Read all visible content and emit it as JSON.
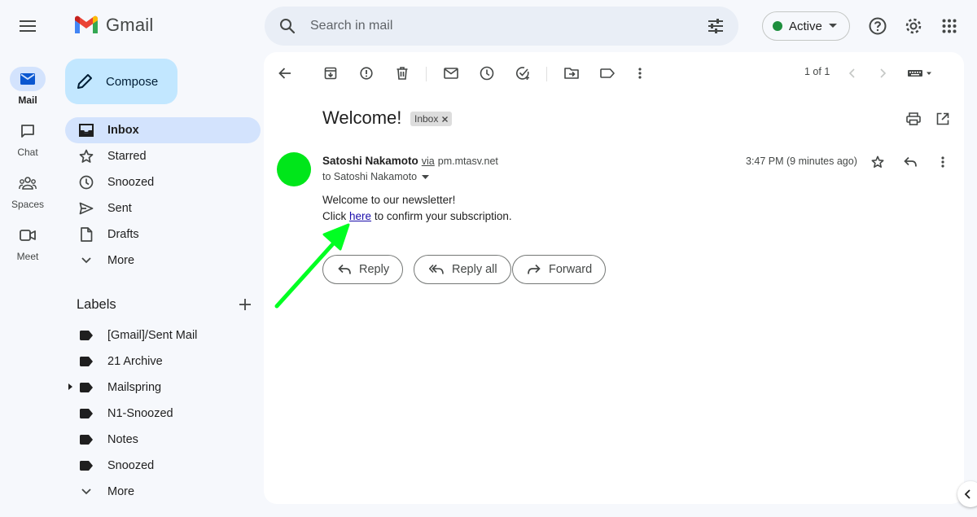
{
  "app": {
    "name": "Gmail"
  },
  "search": {
    "placeholder": "Search in mail"
  },
  "status": {
    "label": "Active",
    "color": "#1e8e3e"
  },
  "rail": [
    {
      "label": "Mail",
      "icon": "mail-icon",
      "active": true
    },
    {
      "label": "Chat",
      "icon": "chat-icon"
    },
    {
      "label": "Spaces",
      "icon": "spaces-icon"
    },
    {
      "label": "Meet",
      "icon": "meet-icon"
    }
  ],
  "compose": {
    "label": "Compose"
  },
  "nav": [
    {
      "label": "Inbox",
      "icon": "inbox-icon",
      "active": true
    },
    {
      "label": "Starred",
      "icon": "star-icon"
    },
    {
      "label": "Snoozed",
      "icon": "clock-icon"
    },
    {
      "label": "Sent",
      "icon": "send-icon"
    },
    {
      "label": "Drafts",
      "icon": "draft-icon"
    },
    {
      "label": "More",
      "icon": "chevron-down-icon"
    }
  ],
  "labels": {
    "title": "Labels",
    "items": [
      {
        "label": "[Gmail]/Sent Mail"
      },
      {
        "label": "21 Archive"
      },
      {
        "label": "Mailspring",
        "expandable": true
      },
      {
        "label": "N1-Snoozed"
      },
      {
        "label": "Notes"
      },
      {
        "label": "Snoozed"
      },
      {
        "label": "More"
      }
    ]
  },
  "toolbar": {
    "pager": "1 of 1"
  },
  "email": {
    "subject": "Welcome!",
    "chip": "Inbox",
    "sender_name": "Satoshi Nakamoto",
    "via": "via",
    "domain": "pm.mtasv.net",
    "recipient": "to Satoshi Nakamoto",
    "timestamp": "3:47 PM (9 minutes ago)",
    "avatar_color": "#00e61a",
    "body_line1": "Welcome to our newsletter!",
    "body_prefix": "Click",
    "body_link": "here",
    "body_suffix": "to confirm your subscription."
  },
  "actions": {
    "reply": "Reply",
    "reply_all": "Reply all",
    "forward": "Forward"
  },
  "annotation": {
    "arrow_color": "#00ff22"
  }
}
